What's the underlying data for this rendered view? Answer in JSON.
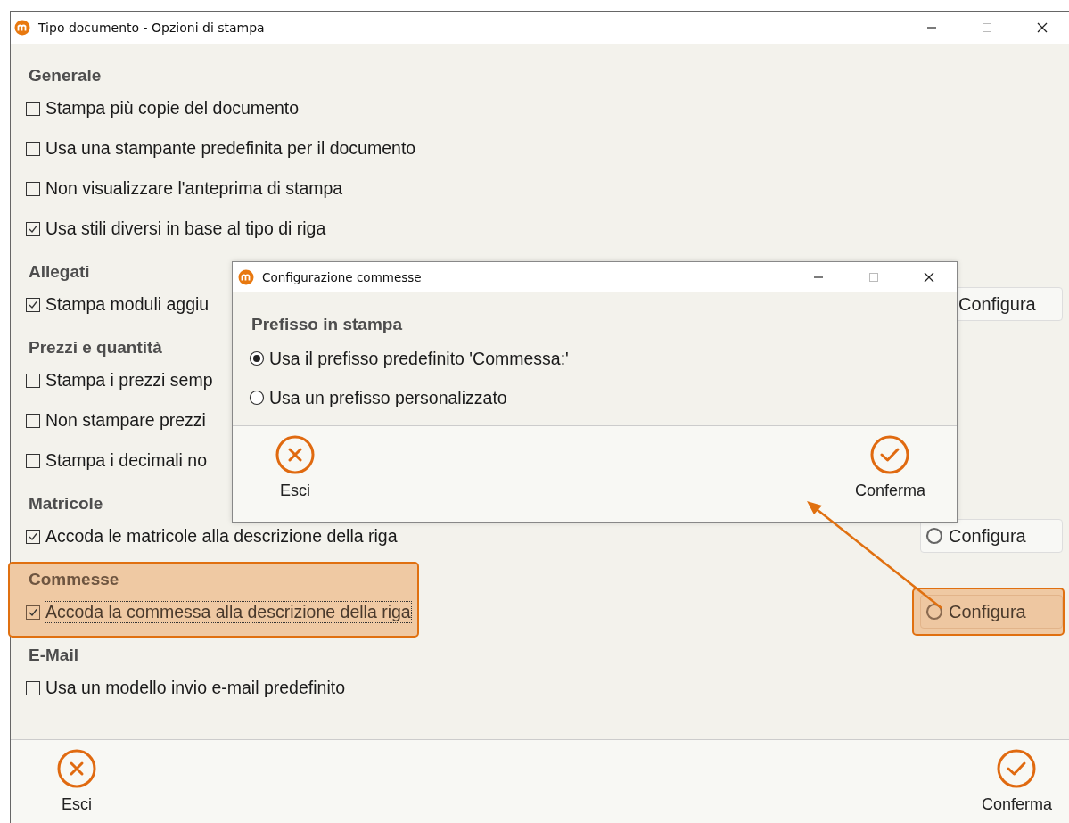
{
  "window": {
    "title": "Tipo documento - Opzioni di stampa"
  },
  "sections": [
    {
      "title": "Generale",
      "highlighted": false,
      "options": [
        {
          "label": "Stampa più copie del documento",
          "checked": false,
          "focused": false
        },
        {
          "label": "Usa una stampante predefinita per il documento",
          "checked": false,
          "focused": false
        },
        {
          "label": "Non visualizzare l'anteprima di stampa",
          "checked": false,
          "focused": false
        },
        {
          "label": "Usa stili diversi in base al tipo di riga",
          "checked": true,
          "focused": false
        }
      ]
    },
    {
      "title": "Allegati",
      "highlighted": false,
      "options": [
        {
          "label": "Stampa moduli aggiu",
          "checked": true,
          "focused": false
        }
      ],
      "configure_button": {
        "label": "Configura",
        "icon": false,
        "highlighted": false
      }
    },
    {
      "title": "Prezzi e quantità",
      "highlighted": false,
      "options": [
        {
          "label": "Stampa i prezzi semp",
          "checked": false,
          "focused": false
        },
        {
          "label": "Non stampare prezzi",
          "checked": false,
          "focused": false
        },
        {
          "label": "Stampa i decimali no",
          "checked": false,
          "focused": false
        }
      ]
    },
    {
      "title": "Matricole",
      "highlighted": false,
      "options": [
        {
          "label": "Accoda le matricole alla descrizione della riga",
          "checked": true,
          "focused": false
        }
      ],
      "configure_button": {
        "label": "Configura",
        "icon": true,
        "highlighted": false
      }
    },
    {
      "title": "Commesse",
      "highlighted": true,
      "options": [
        {
          "label": "Accoda la commessa alla descrizione della riga",
          "checked": true,
          "focused": true
        }
      ],
      "configure_button": {
        "label": "Configura",
        "icon": true,
        "highlighted": true
      }
    },
    {
      "title": "E-Mail",
      "highlighted": false,
      "options": [
        {
          "label": "Usa un modello invio e-mail predefinito",
          "checked": false,
          "focused": false
        }
      ]
    }
  ],
  "footer": [
    {
      "kind": "cancel",
      "label": "Esci"
    },
    {
      "kind": "confirm",
      "label": "Conferma"
    }
  ],
  "dialog": {
    "title": "Configurazione commesse",
    "heading": "Prefisso in stampa",
    "radios": [
      {
        "label": "Usa il prefisso predefinito 'Commessa:'",
        "selected": true
      },
      {
        "label": "Usa un prefisso personalizzato",
        "selected": false
      }
    ],
    "footer": [
      {
        "kind": "cancel",
        "label": "Esci"
      },
      {
        "kind": "confirm",
        "label": "Conferma"
      }
    ]
  }
}
